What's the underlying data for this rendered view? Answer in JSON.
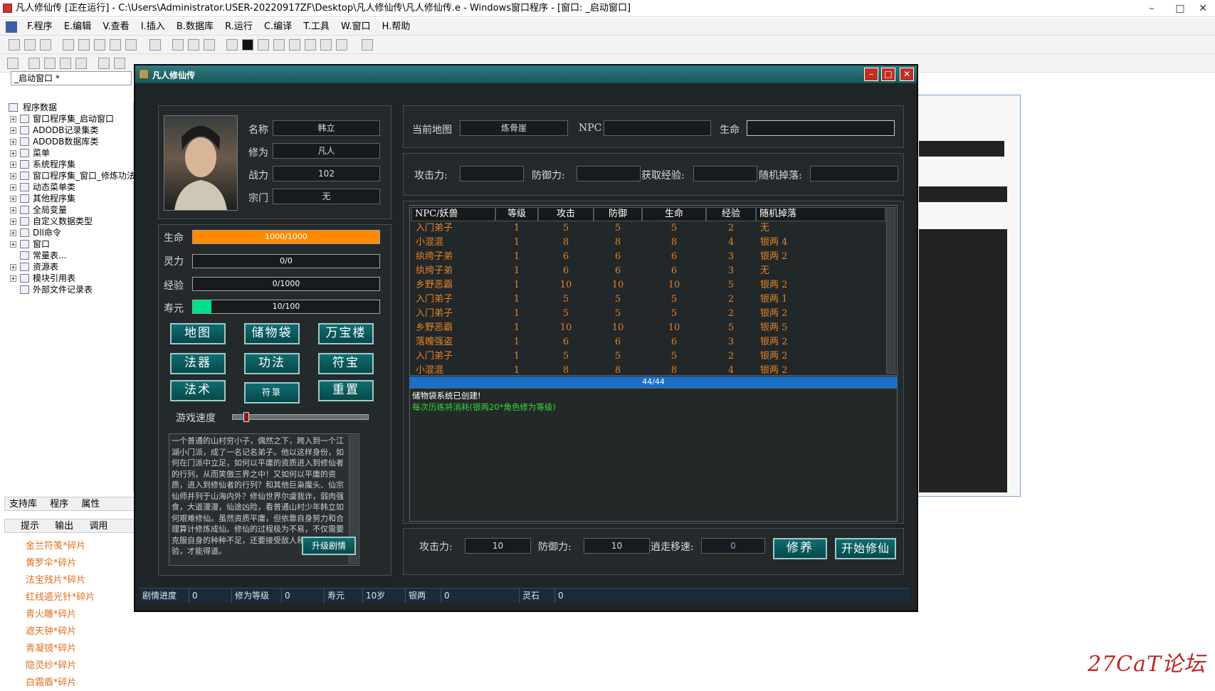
{
  "ide": {
    "title": "凡人修仙传 [正在运行] - C:\\Users\\Administrator.USER-20220917ZF\\Desktop\\凡人修仙传\\凡人修仙传.e - Windows窗口程序 - [窗口: _启动窗口]",
    "menu": [
      "F.程序",
      "E.编辑",
      "V.查看",
      "I.插入",
      "B.数据库",
      "R.运行",
      "C.编译",
      "T.工具",
      "W.窗口",
      "H.帮助"
    ],
    "combo_value": "_启动窗口  *",
    "tree": [
      "程序数据",
      "窗口程序集_启动窗口",
      "ADODB记录集类",
      "ADODB数据库类",
      "菜单",
      "系统程序集",
      "窗口程序集_窗口_修炼功法",
      "动态菜单类",
      "其他程序集",
      "全局变量",
      "自定义数据类型",
      "Dll命令",
      "窗口",
      "常量表...",
      "资源表",
      "模块引用表",
      "外部文件记录表"
    ],
    "bottom_tabs": [
      "支持库",
      "程序",
      "属性"
    ],
    "hint_tabs": [
      "提示",
      "输出",
      "调用"
    ],
    "hints": [
      "金兰符笺*碎片",
      "黄罗伞*碎片",
      "法宝残片*碎片",
      "红线遁光针*碎片",
      "青火雕*碎片",
      "遮天钟*碎片",
      "青凝镜*碎片",
      "隐灵纱*碎片",
      "白霜盾*碎片"
    ],
    "watermark": "27CaT论坛"
  },
  "game": {
    "title": "凡人修仙传",
    "char": {
      "name_label": "名称",
      "name": "韩立",
      "cult_label": "修为",
      "cult": "凡人",
      "power_label": "战力",
      "power": "102",
      "sect_label": "宗门",
      "sect": "无"
    },
    "bars": [
      {
        "label": "生命",
        "text": "1000/1000",
        "fraction": 1.0,
        "color": "#ff8a00"
      },
      {
        "label": "灵力",
        "text": "0/0",
        "fraction": 0.0,
        "color": "#4a8cff"
      },
      {
        "label": "经验",
        "text": "0/1000",
        "fraction": 0.0,
        "color": "#7f5aff"
      },
      {
        "label": "寿元",
        "text": "10/100",
        "fraction": 0.1,
        "color": "#00e08a"
      }
    ],
    "buttons": [
      "地图",
      "储物袋",
      "万宝楼",
      "法器",
      "功法",
      "符宝",
      "法术",
      "符箓",
      "重置"
    ],
    "speed_label": "游戏速度",
    "speed_value": 0.08,
    "story": "一个普通的山村穷小子，偶然之下，跨入到一个江湖小门派，成了一名记名弟子。他以这样身份，如何在门派中立足，如何以平庸的资质进入到修仙者的行列，从而笑傲三界之中！又如何以平庸的资质，进入到修仙者的行列？和其他巨枭魔头、仙宗仙师并列于山海内外？修仙世界尔虞我诈，弱肉强食，大道漫漫，仙途凶险，看普通山村少年韩立如何艰难修仙。虽然资质平庸，但依靠自身努力和合理算计修炼成仙。修仙的过程极为不易，不仅需要克服自身的种种不足，还要接受敌人和天地的考验，才能得道。",
    "upgrade_btn": "升级剧情",
    "map": {
      "map_label": "当前地图",
      "map_value": "炼骨崖",
      "npc_label": "NPC",
      "npc_value": "",
      "hp_label": "生命",
      "hp_value": ""
    },
    "enemy": {
      "atk_label": "攻击力:",
      "def_label": "防御力:",
      "exp_label": "获取经验:",
      "drop_label": "随机掉落:"
    },
    "table": {
      "headers": [
        "NPC/妖兽",
        "等级",
        "攻击",
        "防御",
        "生命",
        "经验",
        "随机掉落"
      ],
      "rows": [
        [
          "入门弟子",
          "1",
          "5",
          "5",
          "5",
          "2",
          "无"
        ],
        [
          "小混混",
          "1",
          "8",
          "8",
          "8",
          "4",
          "银两 4"
        ],
        [
          "纨绔子弟",
          "1",
          "6",
          "6",
          "6",
          "3",
          "银两 2"
        ],
        [
          "纨绔子弟",
          "1",
          "6",
          "6",
          "6",
          "3",
          "无"
        ],
        [
          "乡野恶霸",
          "1",
          "10",
          "10",
          "10",
          "5",
          "银两 2"
        ],
        [
          "入门弟子",
          "1",
          "5",
          "5",
          "5",
          "2",
          "银两 1"
        ],
        [
          "入门弟子",
          "1",
          "5",
          "5",
          "5",
          "2",
          "银两 2"
        ],
        [
          "乡野恶霸",
          "1",
          "10",
          "10",
          "10",
          "5",
          "银两 5"
        ],
        [
          "落魄强盗",
          "1",
          "6",
          "6",
          "6",
          "3",
          "银两 2"
        ],
        [
          "入门弟子",
          "1",
          "5",
          "5",
          "5",
          "2",
          "银两 2"
        ],
        [
          "小混混",
          "1",
          "8",
          "8",
          "8",
          "4",
          "银两 2"
        ]
      ]
    },
    "progress_text": "44/44",
    "log": [
      {
        "text": "储物袋系统已创建!",
        "color": "#ffffff"
      },
      {
        "text": "每次历练将消耗(银两20*角色修为等级)",
        "color": "#33dd33"
      }
    ],
    "player": {
      "atk_label": "攻击力:",
      "atk": "10",
      "def_label": "防御力:",
      "def": "10",
      "spd_label": "逍走移速:",
      "spd": "0"
    },
    "btn_train": "修养",
    "btn_start": "开始修仙",
    "status": [
      "剧情进度",
      "0",
      "修为等级",
      "0",
      "寿元",
      "10岁",
      "银两",
      "0",
      "灵石",
      "0"
    ]
  }
}
